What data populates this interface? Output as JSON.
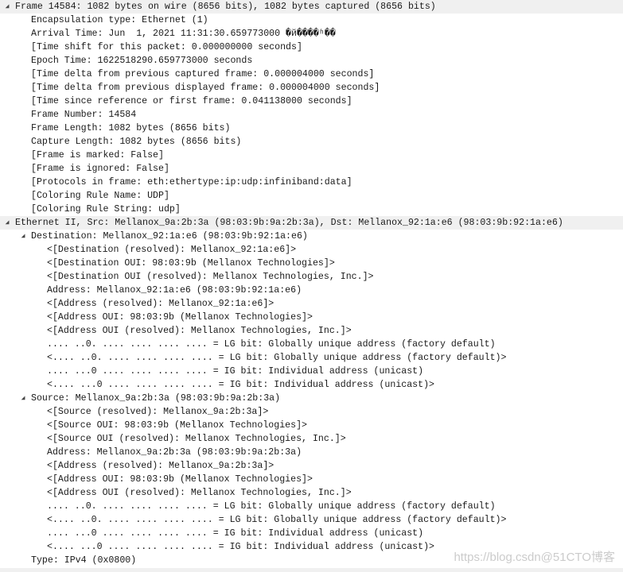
{
  "rows": [
    {
      "level": 0,
      "expander": "expanded",
      "highlight": true,
      "text": "Frame 14584: 1082 bytes on wire (8656 bits), 1082 bytes captured (8656 bits)"
    },
    {
      "level": 1,
      "text": "Encapsulation type: Ethernet (1)"
    },
    {
      "level": 1,
      "text": "Arrival Time: Jun  1, 2021 11:31:30.659773000 �й����ʱ��"
    },
    {
      "level": 1,
      "text": "[Time shift for this packet: 0.000000000 seconds]"
    },
    {
      "level": 1,
      "text": "Epoch Time: 1622518290.659773000 seconds"
    },
    {
      "level": 1,
      "text": "[Time delta from previous captured frame: 0.000004000 seconds]"
    },
    {
      "level": 1,
      "text": "[Time delta from previous displayed frame: 0.000004000 seconds]"
    },
    {
      "level": 1,
      "text": "[Time since reference or first frame: 0.041138000 seconds]"
    },
    {
      "level": 1,
      "text": "Frame Number: 14584"
    },
    {
      "level": 1,
      "text": "Frame Length: 1082 bytes (8656 bits)"
    },
    {
      "level": 1,
      "text": "Capture Length: 1082 bytes (8656 bits)"
    },
    {
      "level": 1,
      "text": "[Frame is marked: False]"
    },
    {
      "level": 1,
      "text": "[Frame is ignored: False]"
    },
    {
      "level": 1,
      "text": "[Protocols in frame: eth:ethertype:ip:udp:infiniband:data]"
    },
    {
      "level": 1,
      "text": "[Coloring Rule Name: UDP]"
    },
    {
      "level": 1,
      "text": "[Coloring Rule String: udp]"
    },
    {
      "level": 0,
      "expander": "expanded",
      "highlight": true,
      "text": "Ethernet II, Src: Mellanox_9a:2b:3a (98:03:9b:9a:2b:3a), Dst: Mellanox_92:1a:e6 (98:03:9b:92:1a:e6)"
    },
    {
      "level": 1,
      "expander": "expanded",
      "text": "Destination: Mellanox_92:1a:e6 (98:03:9b:92:1a:e6)"
    },
    {
      "level": 2,
      "text": "<[Destination (resolved): Mellanox_92:1a:e6]>"
    },
    {
      "level": 2,
      "text": "<[Destination OUI: 98:03:9b (Mellanox Technologies]>"
    },
    {
      "level": 2,
      "text": "<[Destination OUI (resolved): Mellanox Technologies, Inc.]>"
    },
    {
      "level": 2,
      "text": "Address: Mellanox_92:1a:e6 (98:03:9b:92:1a:e6)"
    },
    {
      "level": 2,
      "text": "<[Address (resolved): Mellanox_92:1a:e6]>"
    },
    {
      "level": 2,
      "text": "<[Address OUI: 98:03:9b (Mellanox Technologies]>"
    },
    {
      "level": 2,
      "text": "<[Address OUI (resolved): Mellanox Technologies, Inc.]>"
    },
    {
      "level": 2,
      "text": ".... ..0. .... .... .... .... = LG bit: Globally unique address (factory default)"
    },
    {
      "level": 2,
      "text": "<.... ..0. .... .... .... .... = LG bit: Globally unique address (factory default)>"
    },
    {
      "level": 2,
      "text": ".... ...0 .... .... .... .... = IG bit: Individual address (unicast)"
    },
    {
      "level": 2,
      "text": "<.... ...0 .... .... .... .... = IG bit: Individual address (unicast)>"
    },
    {
      "level": 1,
      "expander": "expanded",
      "text": "Source: Mellanox_9a:2b:3a (98:03:9b:9a:2b:3a)"
    },
    {
      "level": 2,
      "text": "<[Source (resolved): Mellanox_9a:2b:3a]>"
    },
    {
      "level": 2,
      "text": "<[Source OUI: 98:03:9b (Mellanox Technologies]>"
    },
    {
      "level": 2,
      "text": "<[Source OUI (resolved): Mellanox Technologies, Inc.]>"
    },
    {
      "level": 2,
      "text": "Address: Mellanox_9a:2b:3a (98:03:9b:9a:2b:3a)"
    },
    {
      "level": 2,
      "text": "<[Address (resolved): Mellanox_9a:2b:3a]>"
    },
    {
      "level": 2,
      "text": "<[Address OUI: 98:03:9b (Mellanox Technologies]>"
    },
    {
      "level": 2,
      "text": "<[Address OUI (resolved): Mellanox Technologies, Inc.]>"
    },
    {
      "level": 2,
      "text": ".... ..0. .... .... .... .... = LG bit: Globally unique address (factory default)"
    },
    {
      "level": 2,
      "text": "<.... ..0. .... .... .... .... = LG bit: Globally unique address (factory default)>"
    },
    {
      "level": 2,
      "text": ".... ...0 .... .... .... .... = IG bit: Individual address (unicast)"
    },
    {
      "level": 2,
      "text": "<.... ...0 .... .... .... .... = IG bit: Individual address (unicast)>"
    },
    {
      "level": 1,
      "text": "Type: IPv4 (0x0800)"
    }
  ],
  "watermark": "https://blog.csdn@51CTO博客"
}
